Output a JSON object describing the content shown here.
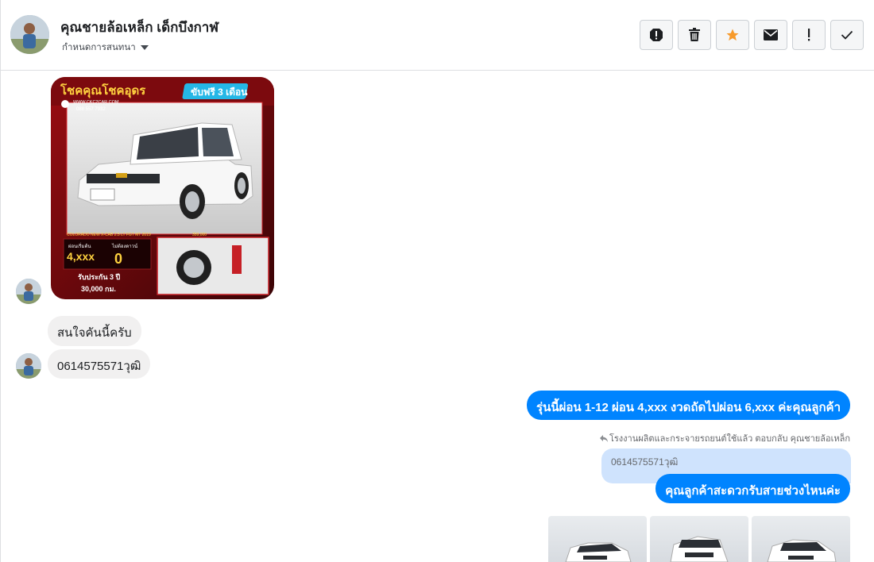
{
  "header": {
    "contact_name": "คุณชายล้อเหล็ก เด็กบึงกาฬ",
    "assign_label": "กำหนดการสนทนา",
    "actions": [
      "spam-icon",
      "trash-icon",
      "star-icon",
      "mail-icon",
      "exclamation-icon",
      "check-icon"
    ]
  },
  "colors": {
    "accent": "#0084ff",
    "star": "#f79a2b",
    "quoted": "#cfe3fd"
  },
  "ad": {
    "headline": "โชคคุณโชคอุดร",
    "badge": "ขับฟรี 3 เดือน",
    "site": "WWW.CKC2CAR.COM",
    "phone": "088 557 7932",
    "model": "COLORADO NEW X-CAB 2.5 LT FGT MT 2019",
    "price": "359,000",
    "installment_label": "ผ่อนเริ่มต้น",
    "installment": "4,xxx",
    "down_label": "ไม่ต้องดาวน์",
    "down": "0",
    "warranty": "รับประกัน 3 ปี",
    "warranty_km": "30,000 กม."
  },
  "messages": {
    "incoming_1": "สนใจคันนี้ครับ",
    "incoming_2": "0614575571วุฒิ",
    "outgoing_1": "รุ่นนี้ผ่อน 1-12 ผ่อน 4,xxx งวดถัดไปผ่อน 6,xxx ค่ะคุณลูกค้า",
    "reply_note": "โรงงานผลิตและกระจายรถยนต์ใช้แล้ว ตอบกลับ คุณชายล้อเหล็ก",
    "quoted_text": "0614575571วุฒิ",
    "outgoing_2": "คุณลูกค้าสะดวกรับสายช่วงไหนค่ะ"
  }
}
